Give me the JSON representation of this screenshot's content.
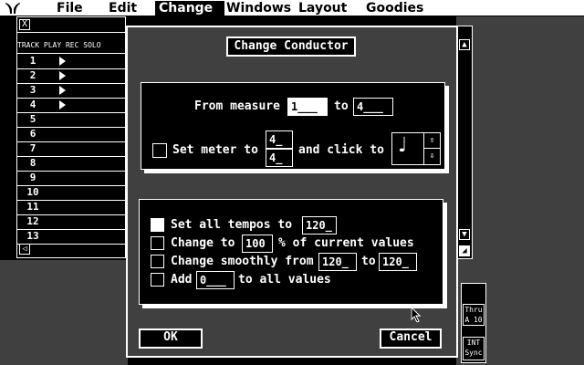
{
  "menubar": {
    "logo": "atari-logo",
    "items": [
      {
        "label": "File"
      },
      {
        "label": "Edit"
      },
      {
        "label": "Change",
        "active": true
      },
      {
        "label": "Windows"
      },
      {
        "label": "Layout"
      },
      {
        "label": "Goodies"
      }
    ]
  },
  "track_window": {
    "headers": "TRACK PLAY REC SOLO",
    "rows": [
      "1",
      "2",
      "3",
      "4",
      "5",
      "6",
      "7",
      "8",
      "9",
      "10",
      "11",
      "12",
      "13"
    ],
    "playing": [
      true,
      true,
      true,
      true,
      false,
      false,
      false,
      false,
      false,
      false,
      false,
      false,
      false
    ]
  },
  "dialog": {
    "title": "Change Conductor",
    "from_label": "From measure",
    "from_value": "1___",
    "to_label": "to",
    "to_value": "4___",
    "meter_label": "Set meter to",
    "meter_num": "4_",
    "meter_den": "4_",
    "click_label": "and click to",
    "click_note": "♩",
    "set_all_label": "Set all tempos to",
    "set_all_value": "120_",
    "change_to_label": "Change to",
    "change_to_value": "100",
    "percent_label": "% of current values",
    "smooth_label": "Change smoothly from",
    "smooth_from": "120_",
    "smooth_to_label": "to",
    "smooth_to": "120_",
    "add_label": "Add",
    "add_value": "0___",
    "add_suffix": "to all values",
    "ok": "OK",
    "cancel": "Cancel"
  },
  "side_panel": {
    "thru": "Thru",
    "thru_sub": "A 10",
    "int": "INT",
    "sync": "Sync"
  },
  "colors": {
    "fg": "#ffffff",
    "bg": "#000000"
  }
}
